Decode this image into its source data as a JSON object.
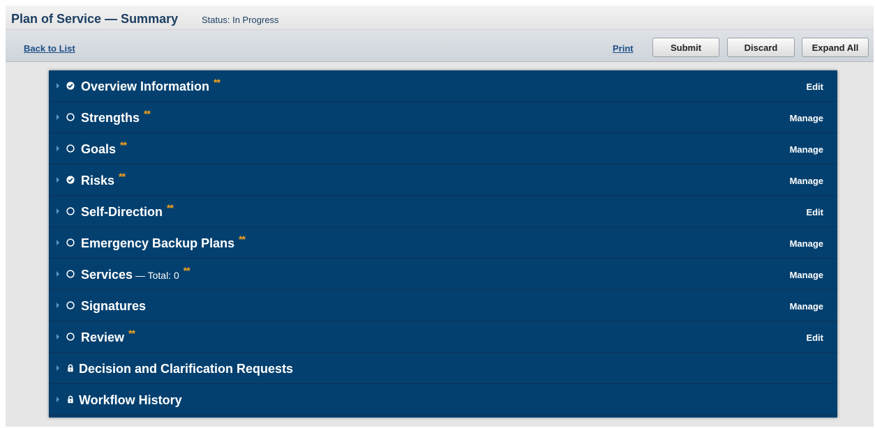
{
  "header": {
    "title": "Plan of Service — Summary",
    "status": "Status: In Progress"
  },
  "toolbar": {
    "back_label": "Back to List",
    "print_label": "Print",
    "submit_label": "Submit",
    "discard_label": "Discard",
    "expand_label": "Expand All"
  },
  "colors": {
    "panel_bg": "#03406f",
    "accent_stars": "#f7a21b",
    "link": "#1d4e86",
    "title": "#1d3f63"
  },
  "sections": [
    {
      "label": "Overview Information",
      "sub": "",
      "stars": "**",
      "action": "Edit",
      "icon": "check-circle-icon"
    },
    {
      "label": "Strengths",
      "sub": "",
      "stars": "**",
      "action": "Manage",
      "icon": "open-circle-icon"
    },
    {
      "label": "Goals",
      "sub": "",
      "stars": "**",
      "action": "Manage",
      "icon": "open-circle-icon"
    },
    {
      "label": "Risks",
      "sub": "",
      "stars": "**",
      "action": "Manage",
      "icon": "check-circle-icon"
    },
    {
      "label": "Self-Direction",
      "sub": "",
      "stars": "**",
      "action": "Edit",
      "icon": "open-circle-icon"
    },
    {
      "label": "Emergency Backup Plans",
      "sub": "",
      "stars": "**",
      "action": "Manage",
      "icon": "open-circle-icon"
    },
    {
      "label": "Services",
      "sub": " — Total: 0",
      "stars": "**",
      "action": "Manage",
      "icon": "open-circle-icon"
    },
    {
      "label": "Signatures",
      "sub": "",
      "stars": "",
      "action": "Manage",
      "icon": "open-circle-icon"
    },
    {
      "label": "Review",
      "sub": "",
      "stars": "**",
      "action": "Edit",
      "icon": "open-circle-icon"
    },
    {
      "label": "Decision and Clarification Requests",
      "sub": "",
      "stars": "",
      "action": "",
      "icon": "lock-icon"
    },
    {
      "label": "Workflow History",
      "sub": "",
      "stars": "",
      "action": "",
      "icon": "lock-icon"
    }
  ]
}
